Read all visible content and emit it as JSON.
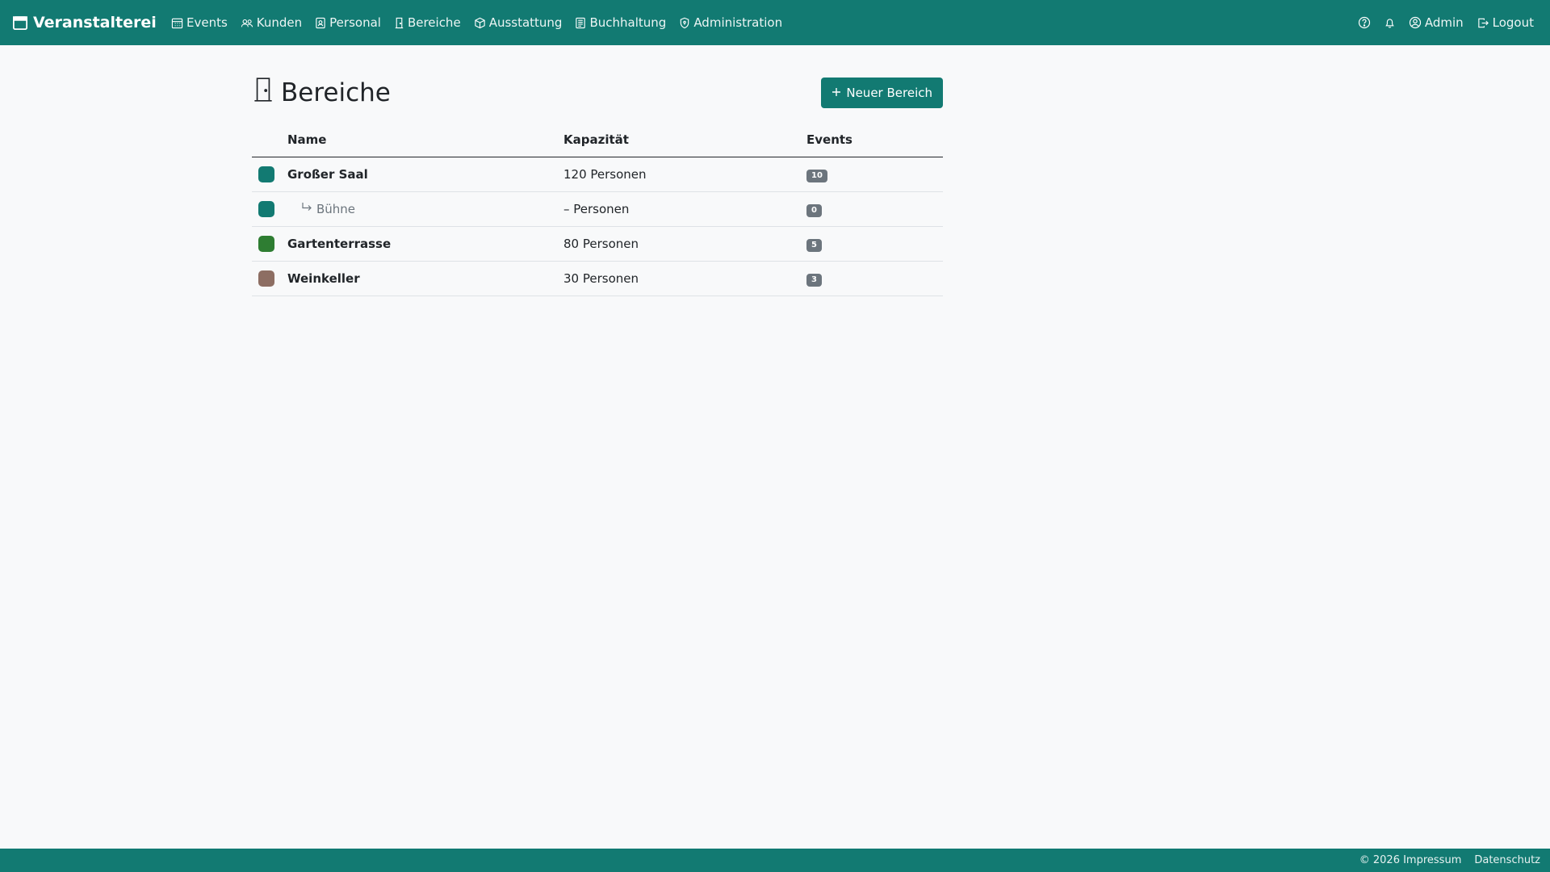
{
  "app": {
    "brand": "Veranstalterei"
  },
  "nav": {
    "items": [
      {
        "label": "Events",
        "icon": "calendar-grid-icon"
      },
      {
        "label": "Kunden",
        "icon": "people-icon"
      },
      {
        "label": "Personal",
        "icon": "badge-icon"
      },
      {
        "label": "Bereiche",
        "icon": "door-icon"
      },
      {
        "label": "Ausstattung",
        "icon": "box-icon"
      },
      {
        "label": "Buchhaltung",
        "icon": "ledger-icon"
      },
      {
        "label": "Administration",
        "icon": "shield-icon"
      }
    ],
    "right": {
      "user_label": "Admin",
      "logout_label": "Logout"
    }
  },
  "page": {
    "title": "Bereiche",
    "new_button_label": "Neuer Bereich"
  },
  "table": {
    "headers": {
      "name": "Name",
      "capacity": "Kapazität",
      "events": "Events"
    },
    "rows": [
      {
        "name": "Großer Saal",
        "capacity": "120 Personen",
        "events": "10",
        "color": "#127a72",
        "child": false
      },
      {
        "name": "Bühne",
        "capacity": "– Personen",
        "events": "0",
        "color": "#127a72",
        "child": true
      },
      {
        "name": "Gartenterrasse",
        "capacity": "80 Personen",
        "events": "5",
        "color": "#2e7d32",
        "child": false
      },
      {
        "name": "Weinkeller",
        "capacity": "30 Personen",
        "events": "3",
        "color": "#8d6e63",
        "child": false
      }
    ]
  },
  "footer": {
    "copyright": "© 2026 Impressum",
    "privacy": "Datenschutz"
  },
  "colors": {
    "primary": "#127a72",
    "badge": "#6c757d",
    "background": "#f8f9fa"
  }
}
